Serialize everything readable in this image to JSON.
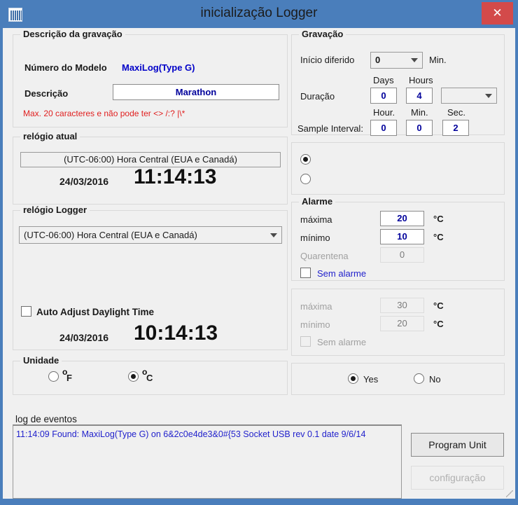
{
  "window": {
    "title": "inicialização Logger",
    "close_label": "✕",
    "icon": "barcode-icon",
    "titlebar_color": "#4a7ebb",
    "close_color": "#d34a4a"
  },
  "recording_description": {
    "legend": "Descrição da gravação",
    "model_label": "Número do Modelo",
    "model_value": "MaxiLog(Type G)",
    "description_label": "Descrição",
    "description_value": "Marathon",
    "hint": "Max. 20 caracteres e não pode ter <> /:? |\\*",
    "hint_color": "#e02020",
    "accent_color": "#0000c8"
  },
  "recording": {
    "legend": "Gravação",
    "deferred_start_label": "Início diferido",
    "deferred_start_value": "0",
    "deferred_start_unit": "Min.",
    "duration_label": "Duração",
    "days_label": "Days",
    "hours_label": "Hours",
    "days_value": "0",
    "hours_value": "4",
    "duration_extra_value": "",
    "sample_interval_label": "Sample Interval:",
    "sample_hour_label": "Hour.",
    "sample_min_label": "Min.",
    "sample_sec_label": "Sec.",
    "sample_hour_value": "0",
    "sample_min_value": "0",
    "sample_sec_value": "2"
  },
  "current_clock": {
    "legend": "relógio atual",
    "timezone": "(UTC-06:00) Hora Central (EUA e Canadá)",
    "date": "24/03/2016",
    "time": "11:14:13"
  },
  "logger_clock": {
    "legend": "relógio Logger",
    "timezone": "(UTC-06:00) Hora Central (EUA e Canadá)",
    "daylight_label": "Auto Adjust Daylight Time",
    "daylight_checked": false,
    "date": "24/03/2016",
    "time": "10:14:13"
  },
  "unit": {
    "legend": "Unidade",
    "fahrenheit_label": "F",
    "fahrenheit_degree": "o",
    "celsius_label": "C",
    "celsius_degree": "o",
    "selected": "C"
  },
  "mode_radios": {
    "option1_label": "",
    "option2_label": "",
    "selected": "option1"
  },
  "alarm_primary": {
    "legend": "Alarme",
    "max_label": "máxima",
    "max_value": "20",
    "max_unit": "°C",
    "min_label": "mínimo",
    "min_value": "10",
    "min_unit": "°C",
    "quarantine_label": "Quarentena",
    "quarantine_value": "0",
    "no_alarm_label": "Sem alarme",
    "no_alarm_checked": false,
    "link_color": "#2222cc"
  },
  "alarm_secondary": {
    "max_label": "máxima",
    "max_value": "30",
    "max_unit": "°C",
    "min_label": "mínimo",
    "min_value": "20",
    "min_unit": "°C",
    "no_alarm_label": "Sem alarme",
    "no_alarm_checked": false,
    "disabled": true
  },
  "yesno": {
    "yes_label": "Yes",
    "no_label": "No",
    "selected": "Yes"
  },
  "event_log": {
    "legend": "log de eventos",
    "lines": [
      "11:14:09 Found: MaxiLog(Type G) on 6&2c0e4de3&0#{53 Socket USB  rev 0.1 date 9/6/14"
    ],
    "text_color": "#2222cc"
  },
  "buttons": {
    "program_unit": "Program Unit",
    "configuration": "configuração",
    "configuration_disabled": true
  }
}
